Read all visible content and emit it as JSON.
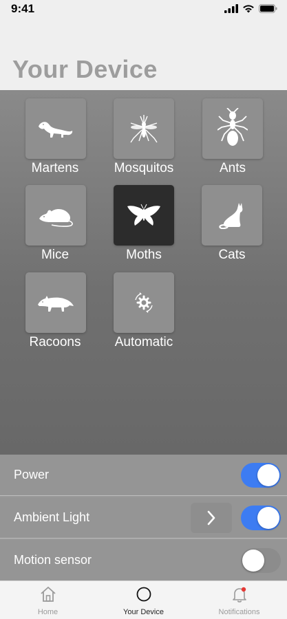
{
  "status": {
    "time": "9:41"
  },
  "header": {
    "title": "Your Device"
  },
  "animals": [
    {
      "label": "Martens",
      "icon": "marten-icon",
      "selected": false
    },
    {
      "label": "Mosquitos",
      "icon": "mosquito-icon",
      "selected": false
    },
    {
      "label": "Ants",
      "icon": "ant-icon",
      "selected": false
    },
    {
      "label": "Mice",
      "icon": "mouse-icon",
      "selected": false
    },
    {
      "label": "Moths",
      "icon": "moth-icon",
      "selected": true
    },
    {
      "label": "Cats",
      "icon": "cat-icon",
      "selected": false
    },
    {
      "label": "Racoons",
      "icon": "racoon-icon",
      "selected": false
    },
    {
      "label": "Automatic",
      "icon": "automatic-icon",
      "selected": false
    }
  ],
  "settings": [
    {
      "label": "Power",
      "toggle_on": true
    },
    {
      "label": "Ambient Light",
      "toggle_on": true,
      "has_chevron": true
    },
    {
      "label": "Motion sensor",
      "toggle_on": false
    }
  ],
  "tabs": [
    {
      "label": "Home",
      "icon": "home-icon",
      "active": false
    },
    {
      "label": "Your Device",
      "icon": "device-icon",
      "active": true
    },
    {
      "label": "Notifications",
      "icon": "bell-icon",
      "active": false,
      "badge_color": "#e53935"
    }
  ],
  "colors": {
    "toggle_on": "#3d7cf2",
    "selected_tile": "#2c2c2c",
    "title": "#9d9d9d"
  }
}
